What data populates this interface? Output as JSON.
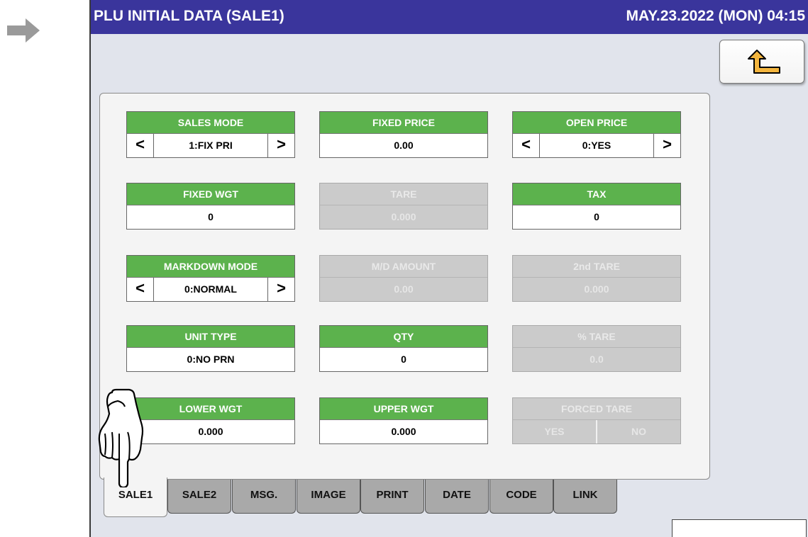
{
  "title": "PLU INITIAL DATA (SALE1)",
  "datetime": "MAY.23.2022 (MON)  04:15",
  "back_icon": "return-arrow-icon",
  "fields": {
    "sales_mode": {
      "label": "SALES MODE",
      "value": "1:FIX PRI"
    },
    "fixed_price": {
      "label": "FIXED PRICE",
      "value": "0.00"
    },
    "open_price": {
      "label": "OPEN PRICE",
      "value": "0:YES"
    },
    "fixed_wgt": {
      "label": "FIXED WGT",
      "value": "0"
    },
    "tare": {
      "label": "TARE",
      "value": "0.000"
    },
    "tax": {
      "label": "TAX",
      "value": "0"
    },
    "markdown_mode": {
      "label": "MARKDOWN MODE",
      "value": "0:NORMAL"
    },
    "md_amount": {
      "label": "M/D AMOUNT",
      "value": "0.00"
    },
    "second_tare": {
      "label": "2nd TARE",
      "value": "0.000"
    },
    "unit_type": {
      "label": "UNIT TYPE",
      "value": "0:NO PRN"
    },
    "qty": {
      "label": "QTY",
      "value": "0"
    },
    "pct_tare": {
      "label": "% TARE",
      "value": "0.0"
    },
    "lower_wgt": {
      "label": "LOWER WGT",
      "value": "0.000"
    },
    "upper_wgt": {
      "label": "UPPER WGT",
      "value": "0.000"
    },
    "forced_tare": {
      "label": "FORCED TARE",
      "yes": "YES",
      "no": "NO"
    }
  },
  "arrows": {
    "left": "<",
    "right": ">"
  },
  "tabs": [
    "SALE1",
    "SALE2",
    "MSG.",
    "IMAGE",
    "PRINT",
    "DATE",
    "CODE",
    "LINK"
  ],
  "active_tab": "SALE1",
  "colors": {
    "titlebar": "#3a359c",
    "field_header": "#5cb24d",
    "background": "#e1e4ec"
  }
}
